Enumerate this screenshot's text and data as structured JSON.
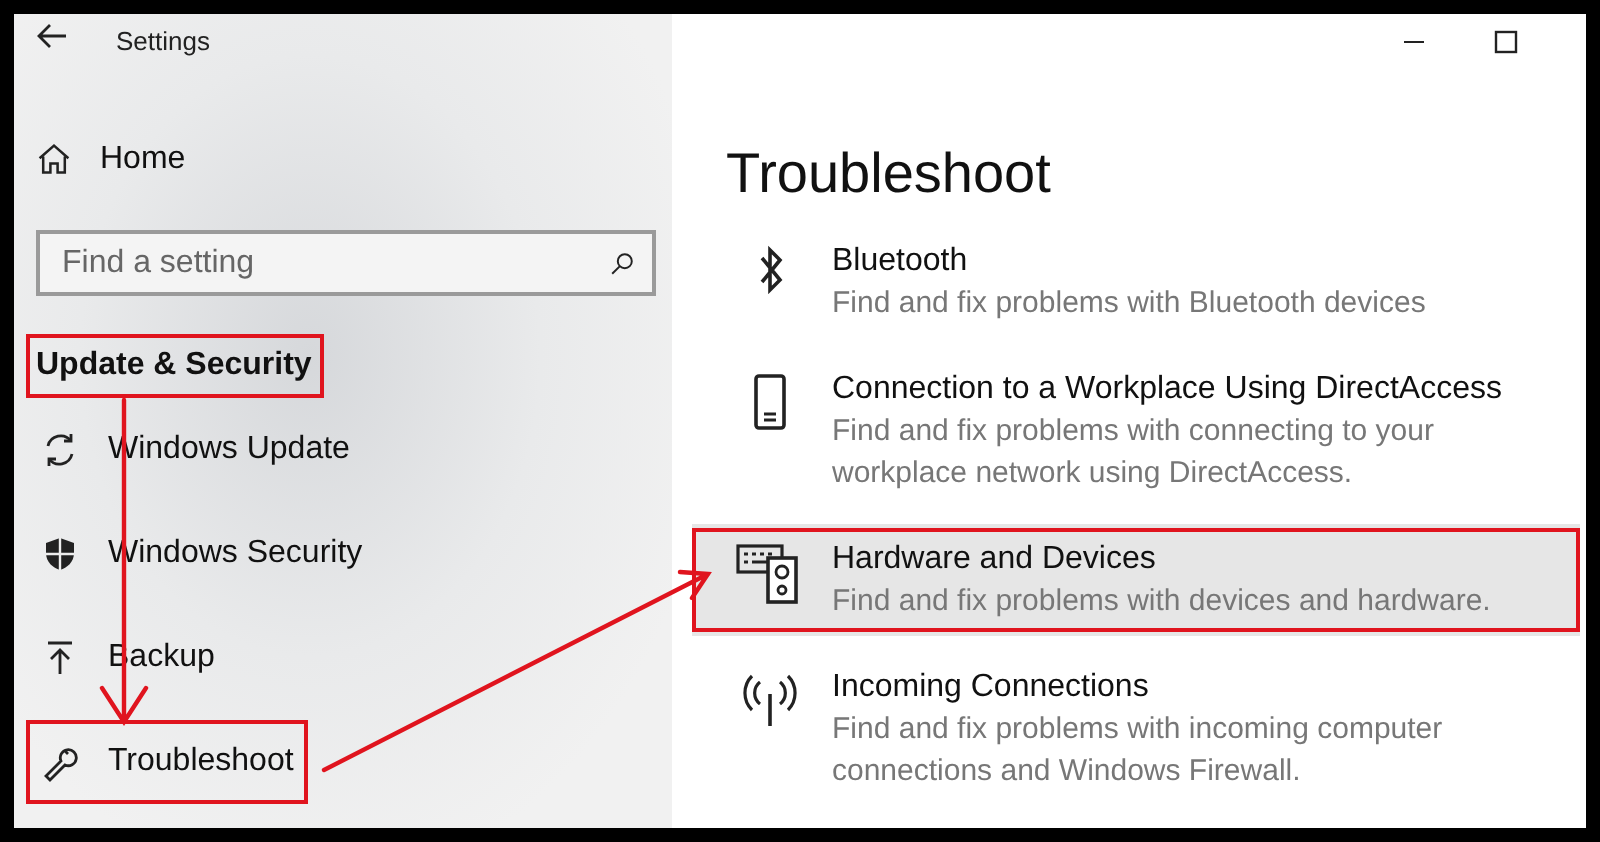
{
  "window": {
    "title": "Settings"
  },
  "sidebar": {
    "home": "Home",
    "search": {
      "placeholder": "Find a setting"
    },
    "heading": {
      "label": "Update & Security",
      "highlighted": true
    },
    "items": [
      {
        "label": "Windows Update",
        "highlighted": false
      },
      {
        "label": "Windows Security",
        "highlighted": false
      },
      {
        "label": "Backup",
        "highlighted": false
      },
      {
        "label": "Troubleshoot",
        "highlighted": true
      }
    ]
  },
  "page": {
    "title": "Troubleshoot",
    "items": [
      {
        "title": "Bluetooth",
        "description": "Find and fix problems with Bluetooth devices",
        "selected": false,
        "highlighted": false
      },
      {
        "title": "Connection to a Workplace Using DirectAccess",
        "description": "Find and fix problems with connecting to your workplace network using DirectAccess.",
        "selected": false,
        "highlighted": false
      },
      {
        "title": "Hardware and Devices",
        "description": "Find and fix problems with devices and hardware.",
        "selected": true,
        "highlighted": true
      },
      {
        "title": "Incoming Connections",
        "description": "Find and fix problems with incoming computer connections and Windows Firewall.",
        "selected": false,
        "highlighted": false
      }
    ]
  }
}
